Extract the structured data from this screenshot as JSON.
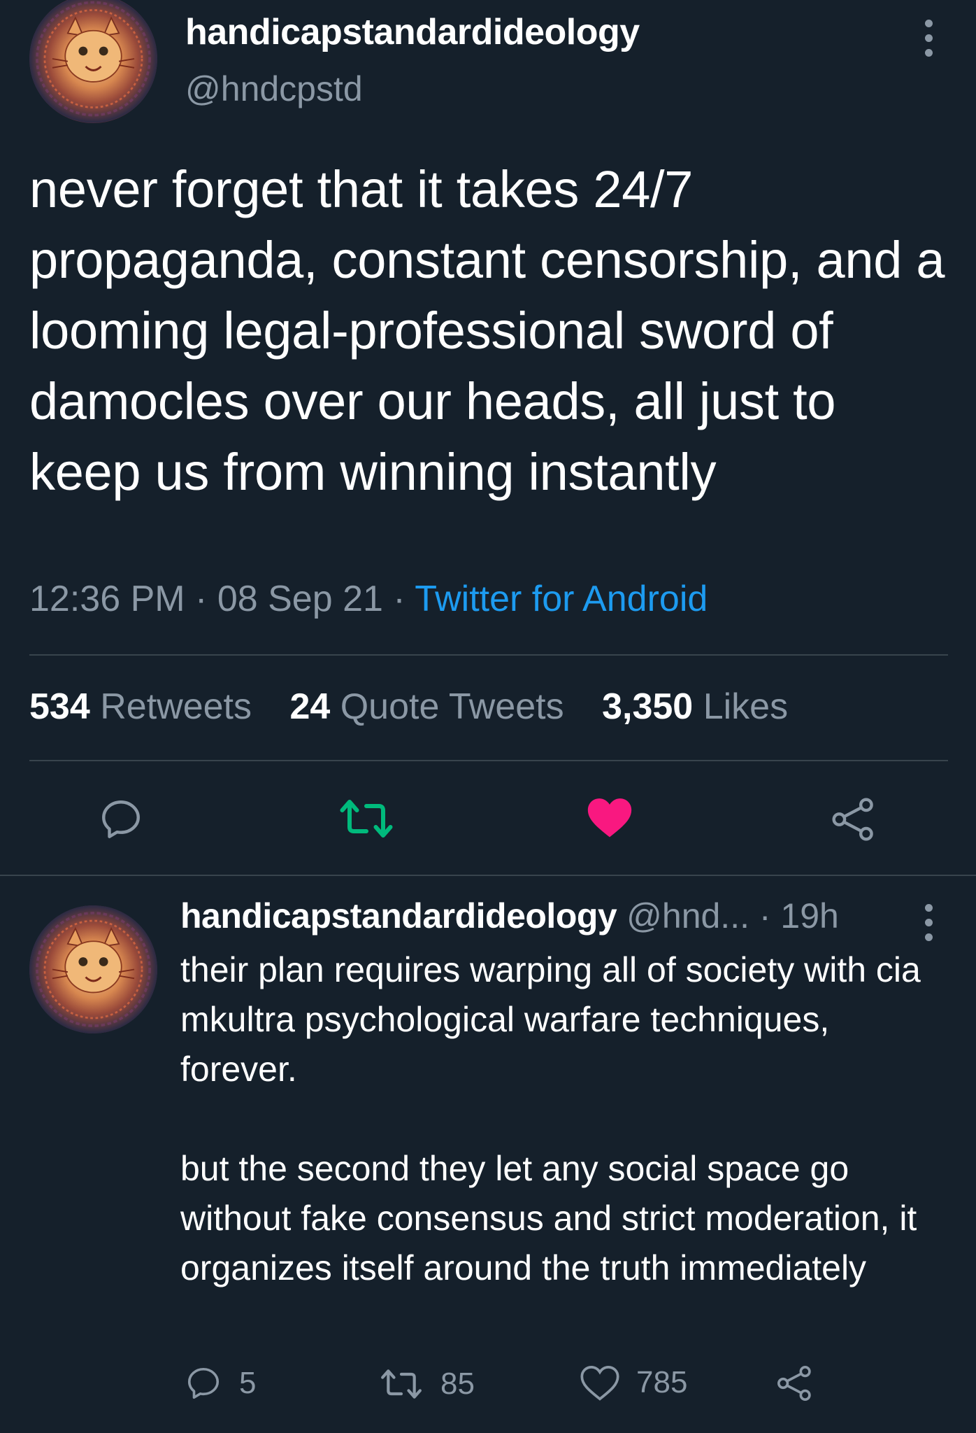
{
  "main_tweet": {
    "display_name": "handicapstandardideology",
    "handle": "@hndcpstd",
    "text": "never forget that it takes 24/7 propaganda, constant censorship, and a looming legal-professional sword of damocles over our heads, all just to keep us from winning instantly",
    "time": "12:36 PM",
    "separator": "·",
    "date": "08 Sep 21",
    "source": "Twitter for Android"
  },
  "stats": {
    "retweets_count": "534",
    "retweets_label": "Retweets",
    "quotes_count": "24",
    "quotes_label": "Quote Tweets",
    "likes_count": "3,350",
    "likes_label": "Likes"
  },
  "actions": {
    "reply_icon": "reply-icon",
    "retweet_icon": "retweet-icon",
    "like_icon": "heart-icon",
    "share_icon": "share-icon",
    "retweet_color": "#00ba7c",
    "like_color": "#f91880"
  },
  "reply_tweet": {
    "display_name": "handicapstandardideology",
    "handle": "@hnd...",
    "age": "· 19h",
    "text": "their plan requires warping all of society with cia mkultra psychological warfare techniques, forever.\n\nbut the second they let any social space go without fake consensus and strict moderation, it organizes itself around the truth immediately",
    "reply_count": "5",
    "retweet_count": "85",
    "like_count": "785"
  },
  "colors": {
    "background": "#15202b",
    "secondary_text": "#8b98a5",
    "link": "#1d9bf0",
    "divider": "#38444d"
  }
}
